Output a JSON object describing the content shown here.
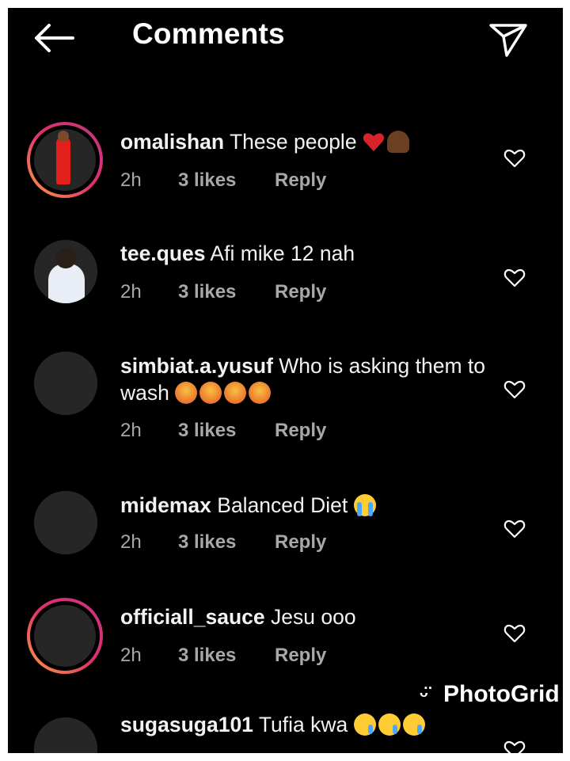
{
  "header": {
    "title": "Comments",
    "back_icon": "arrow-left-icon",
    "send_icon": "paper-plane-icon"
  },
  "comments": [
    {
      "username": "omalishan",
      "text": "These people",
      "emojis": [
        "broken-heart",
        "person-facepalming"
      ],
      "time": "2h",
      "likes": "3 likes",
      "reply": "Reply",
      "avatar": "story-photo"
    },
    {
      "username": "tee.ques",
      "text": "Afi mike 12 nah",
      "emojis": [],
      "time": "2h",
      "likes": "3 likes",
      "reply": "Reply",
      "avatar": "photo"
    },
    {
      "username": "simbiat.a.yusuf",
      "text": "Who is asking them to wash",
      "emojis": [
        "angry-face",
        "angry-face",
        "angry-face",
        "angry-face"
      ],
      "time": "2h",
      "likes": "3 likes",
      "reply": "Reply",
      "avatar": "placeholder"
    },
    {
      "username": "midemax",
      "text": "Balanced Diet",
      "emojis": [
        "loudly-crying-face"
      ],
      "time": "2h",
      "likes": "3 likes",
      "reply": "Reply",
      "avatar": "placeholder"
    },
    {
      "username": "officiall_sauce",
      "text": "Jesu ooo",
      "emojis": [],
      "time": "2h",
      "likes": "3 likes",
      "reply": "Reply",
      "avatar": "story-placeholder"
    },
    {
      "username": "sugasuga101",
      "text": "Tufia kwa",
      "emojis": [
        "sad-crying-face",
        "sad-crying-face",
        "sad-crying-face"
      ],
      "time": "",
      "likes": "",
      "reply": "",
      "avatar": "placeholder"
    }
  ],
  "watermark": {
    "text": "PhotoGrid"
  },
  "colors": {
    "background": "#000000",
    "meta_text": "#a8a8a8",
    "story_ring": "#e1306c"
  }
}
